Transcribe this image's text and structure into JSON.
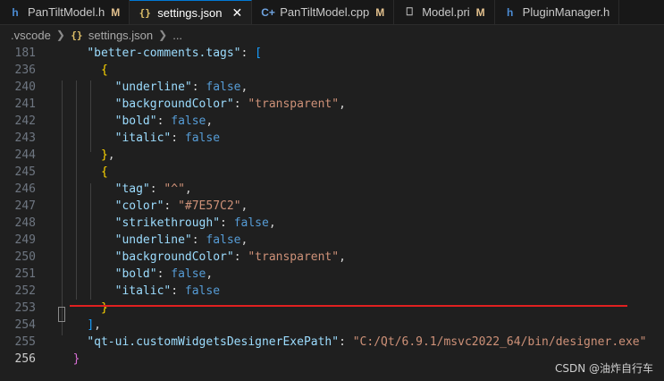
{
  "tabs": [
    {
      "icon": "h-file-icon",
      "name": "PanTiltModel.h",
      "badge": "M",
      "active": false
    },
    {
      "icon": "json-braces-icon",
      "name": "settings.json",
      "badge": "",
      "active": true,
      "close": "✕"
    },
    {
      "icon": "cpp-file-icon",
      "name": "PanTiltModel.cpp",
      "badge": "M",
      "active": false
    },
    {
      "icon": "file-icon",
      "name": "Model.pri",
      "badge": "M",
      "active": false
    },
    {
      "icon": "h-file-icon",
      "name": "PluginManager.h",
      "badge": "",
      "active": false
    }
  ],
  "breadcrumb": {
    "folder": ".vscode",
    "file": "settings.json",
    "more": "..."
  },
  "lines": [
    {
      "n": "181",
      "tokens": [
        [
          "    ",
          "p"
        ],
        [
          "\"better-comments.tags\"",
          "k"
        ],
        [
          ": ",
          "p"
        ],
        [
          "[",
          "br2"
        ]
      ]
    },
    {
      "n": "236",
      "tokens": [
        [
          "      ",
          "p"
        ],
        [
          "{",
          "br3"
        ]
      ]
    },
    {
      "n": "240",
      "tokens": [
        [
          "        ",
          "p"
        ],
        [
          "\"underline\"",
          "k"
        ],
        [
          ": ",
          "p"
        ],
        [
          "false",
          "b"
        ],
        [
          ",",
          "p"
        ]
      ]
    },
    {
      "n": "241",
      "tokens": [
        [
          "        ",
          "p"
        ],
        [
          "\"backgroundColor\"",
          "k"
        ],
        [
          ": ",
          "p"
        ],
        [
          "\"transparent\"",
          "s"
        ],
        [
          ",",
          "p"
        ]
      ]
    },
    {
      "n": "242",
      "tokens": [
        [
          "        ",
          "p"
        ],
        [
          "\"bold\"",
          "k"
        ],
        [
          ": ",
          "p"
        ],
        [
          "false",
          "b"
        ],
        [
          ",",
          "p"
        ]
      ]
    },
    {
      "n": "243",
      "tokens": [
        [
          "        ",
          "p"
        ],
        [
          "\"italic\"",
          "k"
        ],
        [
          ": ",
          "p"
        ],
        [
          "false",
          "b"
        ]
      ]
    },
    {
      "n": "244",
      "tokens": [
        [
          "      ",
          "p"
        ],
        [
          "}",
          "br3"
        ],
        [
          ",",
          "p"
        ]
      ]
    },
    {
      "n": "245",
      "tokens": [
        [
          "      ",
          "p"
        ],
        [
          "{",
          "br3"
        ]
      ]
    },
    {
      "n": "246",
      "tokens": [
        [
          "        ",
          "p"
        ],
        [
          "\"tag\"",
          "k"
        ],
        [
          ": ",
          "p"
        ],
        [
          "\"^\"",
          "s"
        ],
        [
          ",",
          "p"
        ]
      ]
    },
    {
      "n": "247",
      "tokens": [
        [
          "        ",
          "p"
        ],
        [
          "\"color\"",
          "k"
        ],
        [
          ": ",
          "p"
        ],
        [
          "\"#7E57C2\"",
          "s"
        ],
        [
          ",",
          "p"
        ]
      ]
    },
    {
      "n": "248",
      "tokens": [
        [
          "        ",
          "p"
        ],
        [
          "\"strikethrough\"",
          "k"
        ],
        [
          ": ",
          "p"
        ],
        [
          "false",
          "b"
        ],
        [
          ",",
          "p"
        ]
      ]
    },
    {
      "n": "249",
      "tokens": [
        [
          "        ",
          "p"
        ],
        [
          "\"underline\"",
          "k"
        ],
        [
          ": ",
          "p"
        ],
        [
          "false",
          "b"
        ],
        [
          ",",
          "p"
        ]
      ]
    },
    {
      "n": "250",
      "tokens": [
        [
          "        ",
          "p"
        ],
        [
          "\"backgroundColor\"",
          "k"
        ],
        [
          ": ",
          "p"
        ],
        [
          "\"transparent\"",
          "s"
        ],
        [
          ",",
          "p"
        ]
      ]
    },
    {
      "n": "251",
      "tokens": [
        [
          "        ",
          "p"
        ],
        [
          "\"bold\"",
          "k"
        ],
        [
          ": ",
          "p"
        ],
        [
          "false",
          "b"
        ],
        [
          ",",
          "p"
        ]
      ]
    },
    {
      "n": "252",
      "tokens": [
        [
          "        ",
          "p"
        ],
        [
          "\"italic\"",
          "k"
        ],
        [
          ": ",
          "p"
        ],
        [
          "false",
          "b"
        ]
      ]
    },
    {
      "n": "253",
      "tokens": [
        [
          "      ",
          "p"
        ],
        [
          "}",
          "br3"
        ]
      ]
    },
    {
      "n": "254",
      "tokens": [
        [
          "    ",
          "p"
        ],
        [
          "]",
          "br2"
        ],
        [
          ",",
          "p"
        ]
      ]
    },
    {
      "n": "255",
      "tokens": [
        [
          "    ",
          "p"
        ],
        [
          "\"qt-ui.customWidgetsDesignerExePath\"",
          "k"
        ],
        [
          ": ",
          "p"
        ],
        [
          "\"C:/Qt/6.9.1/msvc2022_64/bin/designer.exe\"",
          "s"
        ]
      ]
    },
    {
      "n": "256",
      "tokens": [
        [
          "  ",
          "p"
        ],
        [
          "}",
          "br1"
        ]
      ],
      "current": true
    }
  ],
  "watermark": "CSDN @油炸自行车",
  "colors": {
    "modified": "#e2c08d",
    "underline": "#e02020",
    "accent": "#0078d4"
  }
}
